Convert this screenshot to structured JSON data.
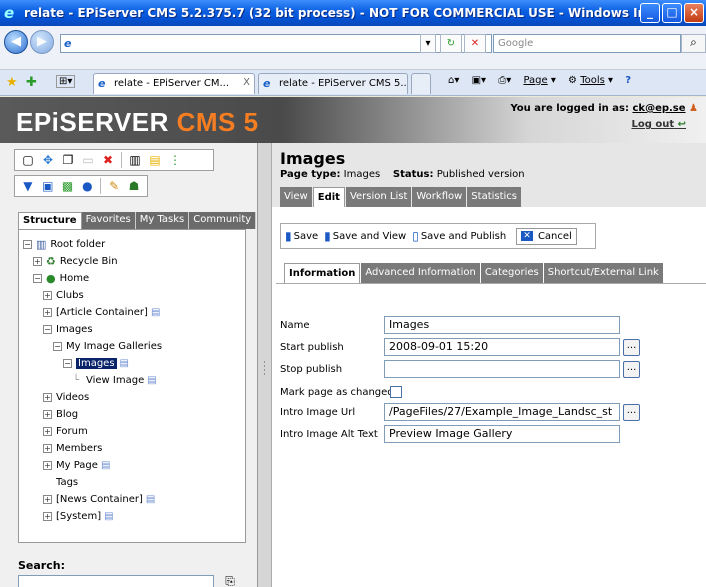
{
  "window": {
    "title": "relate - EPiServer CMS 5.2.375.7 (32 bit process) - NOT FOR COMMERCIAL USE - Windows Internet Explorer"
  },
  "browser": {
    "address": "e",
    "search_placeholder": "Google",
    "tabs": [
      {
        "label": "relate - EPiServer CM...",
        "close": "X"
      },
      {
        "label": "relate - EPiServer CMS 5..."
      }
    ],
    "commands": {
      "page": "Page",
      "tools": "Tools"
    }
  },
  "header": {
    "logo_main": "EPiSERVER",
    "logo_cms": " CMS 5",
    "logged_in_prefix": "You are logged in as:",
    "user": "ck@ep.se",
    "logout": "Log out"
  },
  "left": {
    "tabs": [
      "Structure",
      "Favorites",
      "My Tasks",
      "Community"
    ],
    "tree": [
      {
        "label": "Root folder",
        "indent": 0,
        "exp": "−",
        "icon": "root"
      },
      {
        "label": "Recycle Bin",
        "indent": 1,
        "exp": "+",
        "icon": "bin"
      },
      {
        "label": "Home",
        "indent": 1,
        "exp": "−",
        "icon": "home"
      },
      {
        "label": "Clubs",
        "indent": 2,
        "exp": "+"
      },
      {
        "label": "[Article Container]",
        "indent": 2,
        "exp": "+",
        "page": true
      },
      {
        "label": "Images",
        "indent": 2,
        "exp": "−"
      },
      {
        "label": "My Image Galleries",
        "indent": 3,
        "exp": "−"
      },
      {
        "label": "Images",
        "indent": 4,
        "exp": "−",
        "page": true,
        "selected": true
      },
      {
        "label": "View Image",
        "indent": 5,
        "exp": "",
        "page": true
      },
      {
        "label": "Videos",
        "indent": 2,
        "exp": "+"
      },
      {
        "label": "Blog",
        "indent": 2,
        "exp": "+"
      },
      {
        "label": "Forum",
        "indent": 2,
        "exp": "+"
      },
      {
        "label": "Members",
        "indent": 2,
        "exp": "+"
      },
      {
        "label": "My Page",
        "indent": 2,
        "exp": "+",
        "page": true
      },
      {
        "label": "Tags",
        "indent": 2,
        "exp": ""
      },
      {
        "label": "[News Container]",
        "indent": 2,
        "exp": "+",
        "page": true
      },
      {
        "label": "[System]",
        "indent": 2,
        "exp": "+",
        "page": true
      }
    ],
    "search_label": "Search:"
  },
  "page": {
    "title": "Images",
    "type_label": "Page type:",
    "type_value": "Images",
    "status_label": "Status:",
    "status_value": "Published version",
    "edit_tabs": [
      "View",
      "Edit",
      "Version List",
      "Workflow",
      "Statistics"
    ],
    "actions": {
      "save": "Save",
      "save_view": "Save and View",
      "save_publish": "Save and Publish",
      "cancel": "Cancel"
    },
    "prop_tabs": [
      "Information",
      "Advanced Information",
      "Categories",
      "Shortcut/External Link"
    ],
    "fields": {
      "name": {
        "label": "Name",
        "value": "Images"
      },
      "start_publish": {
        "label": "Start publish",
        "value": "2008-09-01 15:20"
      },
      "stop_publish": {
        "label": "Stop publish",
        "value": ""
      },
      "mark_changed": {
        "label": "Mark page as changed"
      },
      "intro_url": {
        "label": "Intro Image Url",
        "value": "/PageFiles/27/Example_Image_Landsc_st"
      },
      "intro_alt": {
        "label": "Intro Image Alt Text",
        "value": "Preview Image Gallery"
      }
    }
  }
}
